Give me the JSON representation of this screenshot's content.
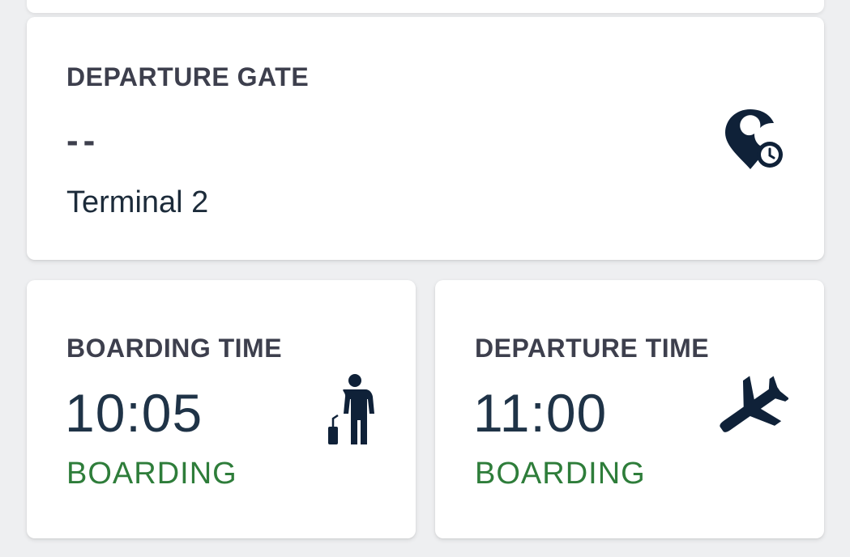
{
  "departure_gate": {
    "label": "DEPARTURE GATE",
    "value": "--",
    "terminal": "Terminal 2",
    "icon": "location-clock-icon"
  },
  "boarding_time": {
    "label": "BOARDING TIME",
    "time": "10:05",
    "status": "BOARDING",
    "icon": "passenger-luggage-icon"
  },
  "departure_time": {
    "label": "DEPARTURE TIME",
    "time": "11:00",
    "status": "BOARDING",
    "icon": "airplane-icon"
  },
  "colors": {
    "icon": "#0f2138",
    "label": "#3d3f4d",
    "status": "#2e7d3a",
    "background": "#eeeff1"
  }
}
